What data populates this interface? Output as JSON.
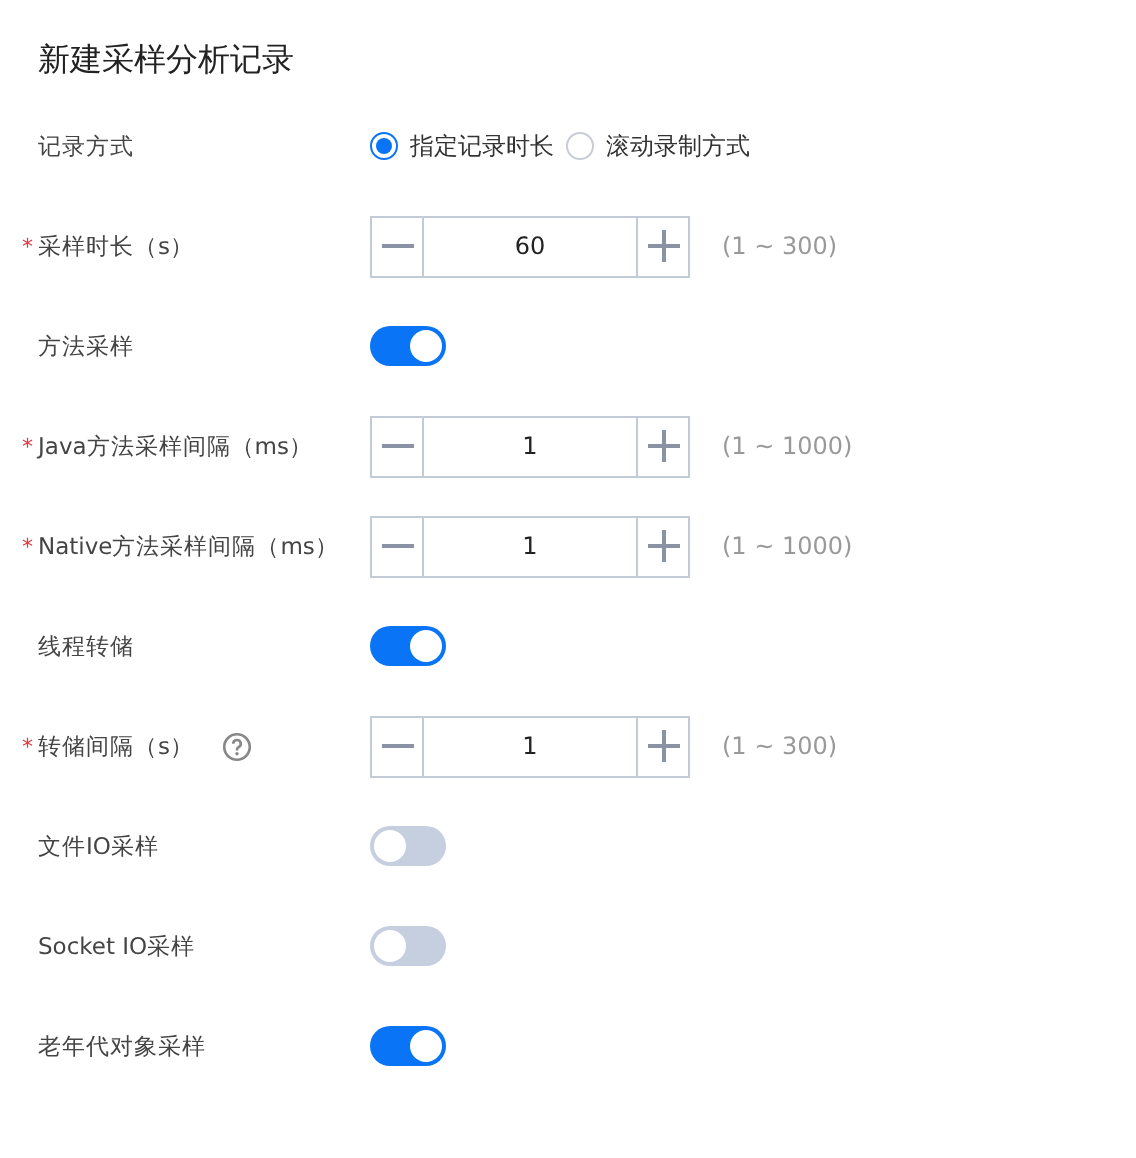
{
  "title": "新建采样分析记录",
  "fields": [
    {
      "kind": "radio",
      "label": "记录方式",
      "options": [
        {
          "label": "指定记录时长",
          "selected": true
        },
        {
          "label": "滚动录制方式",
          "selected": false
        }
      ]
    },
    {
      "kind": "stepper",
      "mark": "*",
      "label": "采样时长（s）",
      "value": "60",
      "range": "(1 ~ 300)"
    },
    {
      "kind": "switch",
      "label": "方法采样",
      "on": true
    },
    {
      "kind": "stepper",
      "mark": "*",
      "label": "Java方法采样间隔（ms）",
      "value": "1",
      "range": "(1 ~ 1000)"
    },
    {
      "kind": "stepper",
      "mark": "*",
      "label": "Native方法采样间隔（ms）",
      "value": "1",
      "range": "(1 ~ 1000)"
    },
    {
      "kind": "switch",
      "label": "线程转储",
      "on": true
    },
    {
      "kind": "stepper",
      "mark": "*",
      "label": "转储间隔（s）",
      "help": true,
      "value": "1",
      "range": "(1 ~ 300)"
    },
    {
      "kind": "switch",
      "label": "文件IO采样",
      "on": false
    },
    {
      "kind": "switch",
      "label": "Socket IO采样",
      "on": false
    },
    {
      "kind": "switch",
      "label": "老年代对象采样",
      "on": true
    }
  ]
}
